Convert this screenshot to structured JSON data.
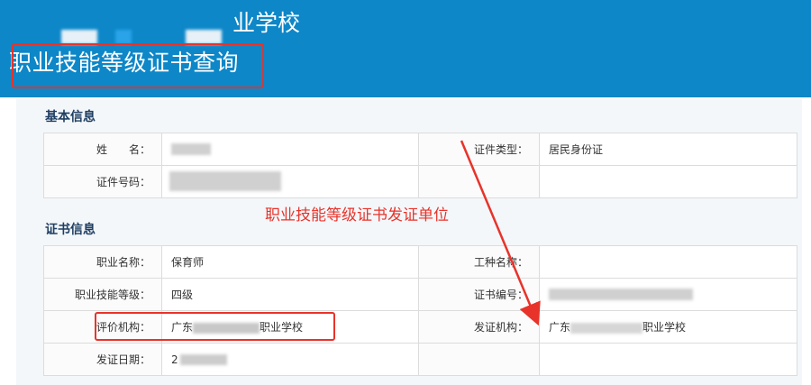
{
  "header": {
    "school_name_visible": "业学校",
    "page_title": "职业技能等级证书查询"
  },
  "basic_info": {
    "section_title": "基本信息",
    "name_label": "姓　　名：",
    "id_type_label": "证件类型：",
    "id_type_value": "居民身份证",
    "id_number_label": "证件号码："
  },
  "cert_info": {
    "section_title": "证书信息",
    "occupation_label": "职业名称：",
    "occupation_value": "保育师",
    "job_type_label": "工种名称：",
    "skill_level_label": "职业技能等级：",
    "skill_level_value": "四级",
    "cert_no_label": "证书编号：",
    "eval_org_label": "评价机构：",
    "eval_org_prefix": "广东",
    "eval_org_suffix": "职业学校",
    "issue_org_label": "发证机构：",
    "issue_org_prefix": "广东",
    "issue_org_suffix": "职业学校",
    "issue_date_label": "发证日期：",
    "issue_date_prefix": "2"
  },
  "annotation": {
    "text": "职业技能等级证书发证单位",
    "color": "#e8332a"
  },
  "colors": {
    "header_bg": "#0d87c8",
    "section_title": "#1f3e62"
  }
}
